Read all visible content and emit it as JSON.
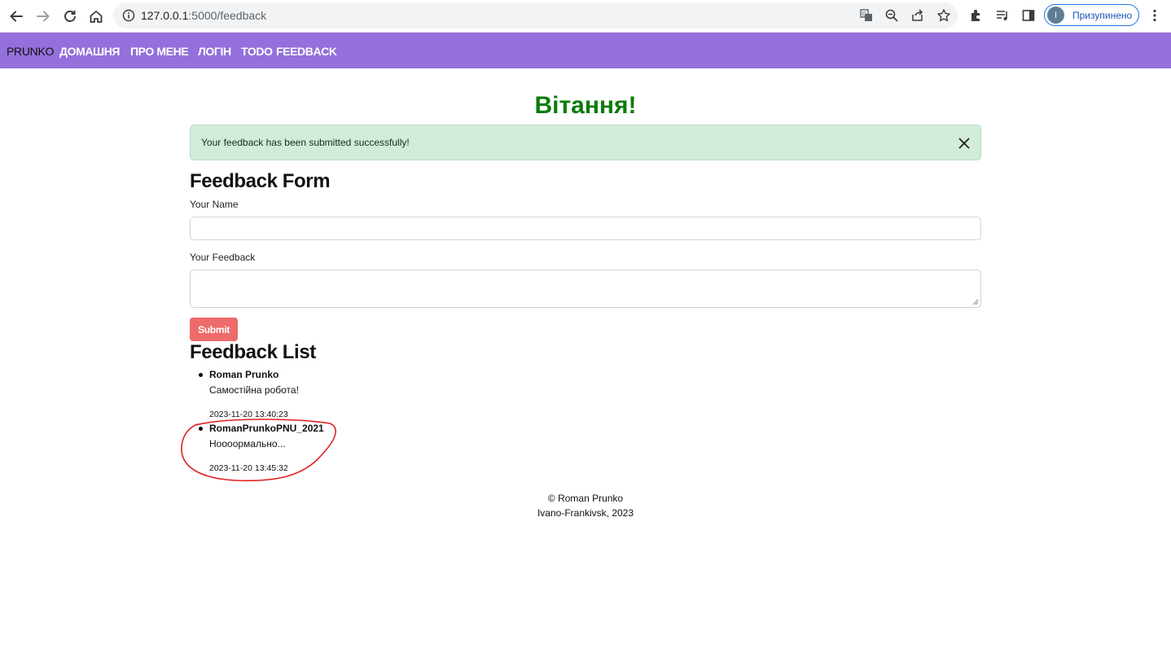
{
  "browser": {
    "url_host": "127.0.0.1",
    "url_rest": ":5000/feedback",
    "profile_initial": "I",
    "profile_label": "Призупинено"
  },
  "navbar": {
    "brand": "PRUNKO",
    "links": [
      "ДОМАШНЯ",
      "ПРО МЕНЕ",
      "ЛОГІН",
      "TODO",
      "FEEDBACK"
    ]
  },
  "page": {
    "heading": "Вітання!",
    "alert": "Your feedback has been submitted successfully!",
    "form_title": "Feedback Form",
    "name_label": "Your Name",
    "feedback_label": "Your Feedback",
    "submit_label": "Submit",
    "list_title": "Feedback List"
  },
  "feedback": [
    {
      "name": "Roman Prunko",
      "text": "Самостійна робота!",
      "date": "2023-11-20 13:40:23"
    },
    {
      "name": "RomanPrunkoPNU_2021",
      "text": "Ноооормально...",
      "date": "2023-11-20 13:45:32"
    }
  ],
  "footer": {
    "line1": "© Roman Prunko",
    "line2": "Ivano-Frankivsk, 2023"
  },
  "colors": {
    "navbar": "#9370db",
    "heading": "#0a7c0a",
    "alert_bg": "#d1ecd9",
    "submit": "#ee6b6b",
    "annotation": "#e02020"
  }
}
